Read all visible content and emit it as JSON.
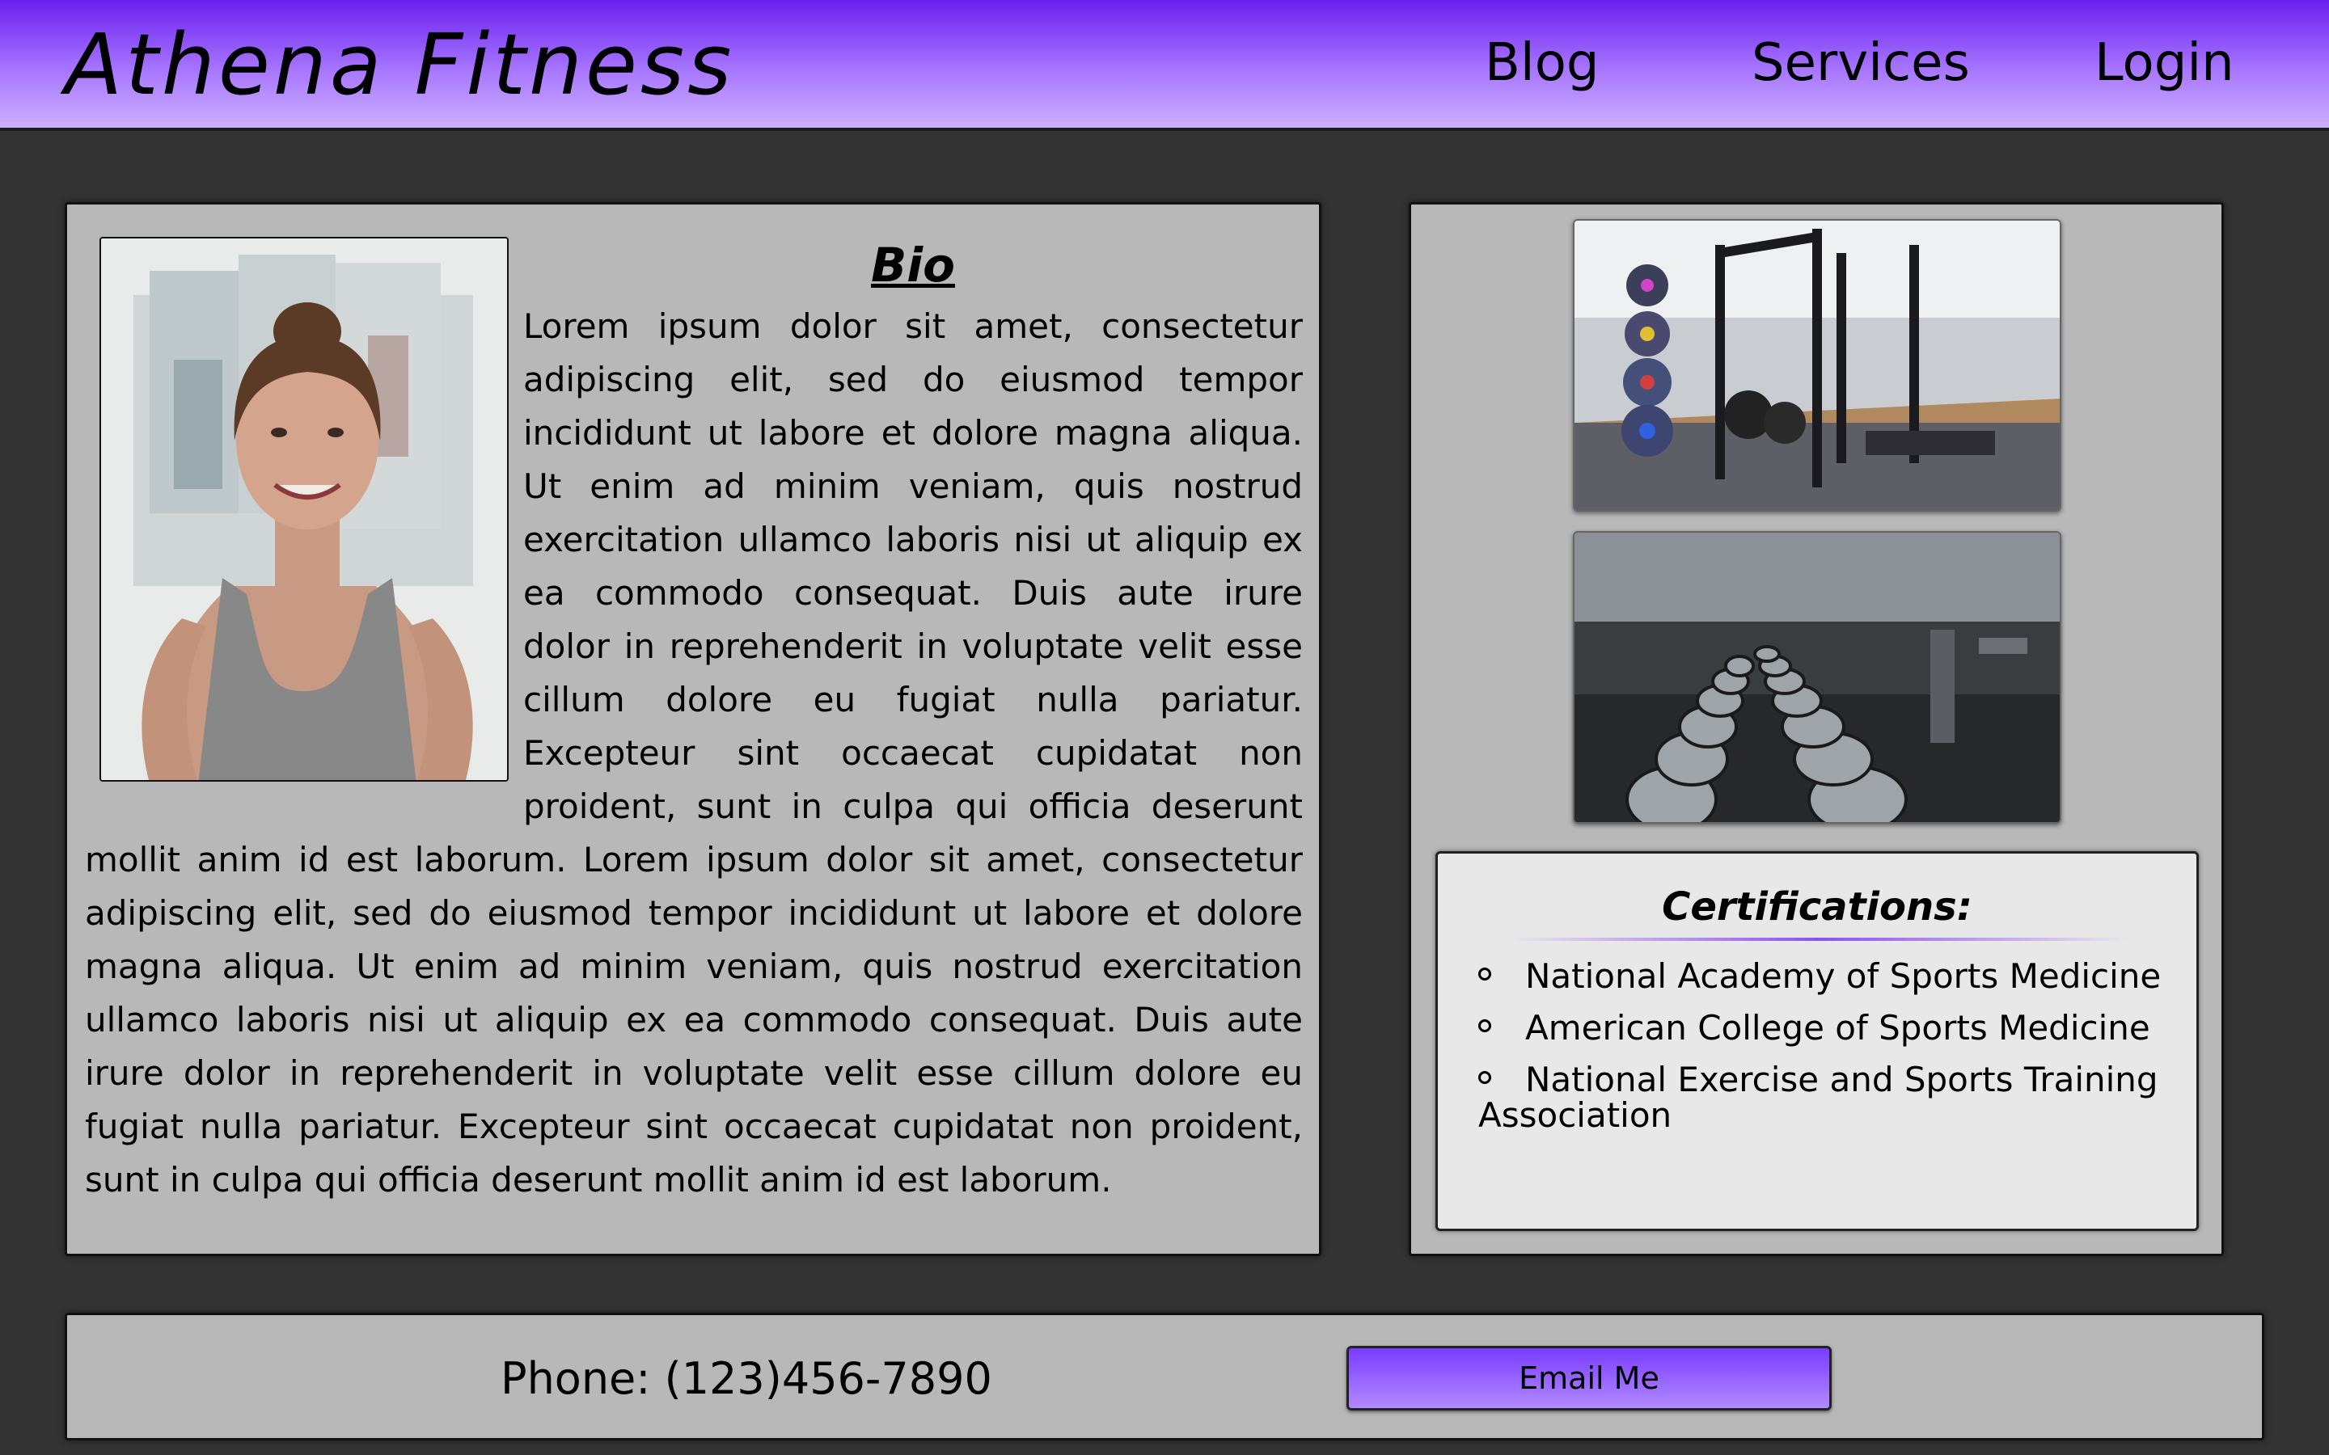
{
  "header": {
    "brand": "Athena Fitness",
    "nav": {
      "blog": "Blog",
      "services": "Services",
      "login": "Login"
    }
  },
  "bio": {
    "title": "Bio",
    "text": "Lorem ipsum dolor sit amet, consectetur adipiscing elit, sed do eiusmod tempor incididunt ut labore et dolore magna aliqua. Ut enim ad minim veniam, quis nostrud exercitation ullamco laboris nisi ut aliquip ex ea commodo consequat. Duis aute irure dolor in reprehenderit in voluptate velit esse cillum dolore eu fugiat nulla pariatur. Excepteur sint occaecat cupidatat non proident, sunt in culpa qui officia deserunt mollit anim id est laborum. Lorem ipsum dolor sit amet, consectetur adipiscing elit, sed do eiusmod tempor incididunt ut labore et dolore magna aliqua. Ut enim ad minim veniam, quis nostrud exercitation ullamco laboris nisi ut aliquip ex ea commodo consequat. Duis aute irure dolor in reprehenderit in voluptate velit esse cillum dolore eu fugiat nulla pariatur. Excepteur sint occaecat cupidatat non proident, sunt in culpa qui officia deserunt mollit anim id est laborum."
  },
  "certifications": {
    "title": "Certifications:",
    "items": [
      "National Academy of Sports Medicine",
      "American College of Sports Medicine",
      "National Exercise and Sports Training Association"
    ]
  },
  "footer": {
    "phone": "Phone: (123)456-7890",
    "email_button": "Email Me"
  },
  "colors": {
    "header_top": "#6a1fee",
    "header_bottom": "#cdb0ff",
    "page_bg": "#333333",
    "panel_bg": "#b8b8b8",
    "cert_bg": "#e8e8e8",
    "button_top": "#7a3cff",
    "button_bottom": "#b18aff"
  }
}
